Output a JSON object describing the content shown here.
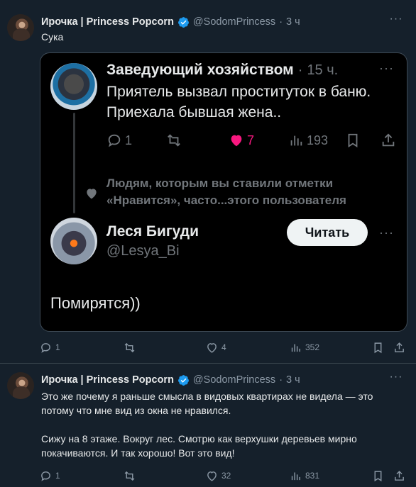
{
  "tweet1": {
    "author_name": "Ирочка | Princess Popcorn",
    "handle": "@SodomPrincess",
    "separator": "·",
    "time": "3 ч",
    "text": "Сука",
    "card": {
      "author_name": "Заведующий хозяйством",
      "separator": "·",
      "time": "15 ч.",
      "text": "Приятель вызвал проституток в баню. Приехала бывшая жена..",
      "replies": "1",
      "likes": "7",
      "views": "193",
      "suggestion": "Людям, которым вы ставили отметки «Нравится», часто...этого пользователя",
      "suggested_name": "Леся Бигуди",
      "suggested_handle": "@Lesya_Bi",
      "follow_label": "Читать",
      "reply_text": "Помирятся))"
    },
    "replies": "1",
    "likes": "4",
    "views": "352"
  },
  "tweet2": {
    "author_name": "Ирочка | Princess Popcorn",
    "handle": "@SodomPrincess",
    "separator": "·",
    "time": "3 ч",
    "text": "Это же почему я раньше смысла в видовых квартирах не видела — это потому что мне вид из окна не нравился.\n\nСижу на 8 этаже. Вокруг лес. Смотрю как верхушки деревьев мирно покачиваются. И так хорошо! Вот это вид!",
    "replies": "1",
    "likes": "32",
    "views": "831"
  },
  "colors": {
    "background": "#15202b",
    "card_background": "#000000",
    "verified": "#1d9bf0",
    "like_active": "#f91880",
    "muted": "#8b98a5"
  }
}
